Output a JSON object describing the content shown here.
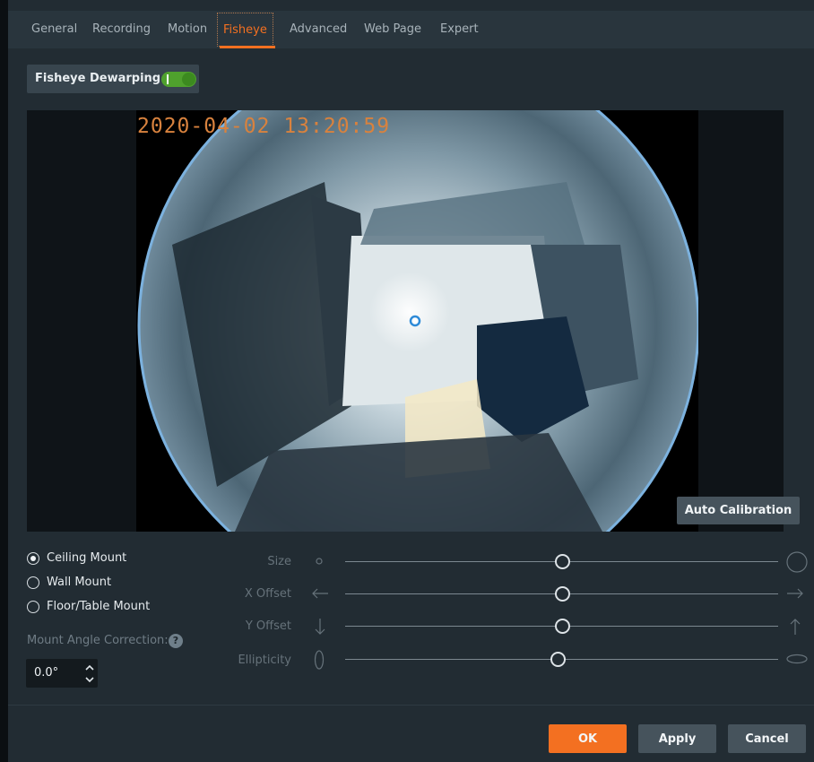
{
  "tabs": [
    {
      "label": "General",
      "active": false
    },
    {
      "label": "Recording",
      "active": false
    },
    {
      "label": "Motion",
      "active": false
    },
    {
      "label": "Fisheye",
      "active": true
    },
    {
      "label": "Advanced",
      "active": false
    },
    {
      "label": "Web Page",
      "active": false
    },
    {
      "label": "Expert",
      "active": false
    }
  ],
  "dewarping": {
    "label": "Fisheye Dewarping",
    "enabled": true
  },
  "video": {
    "timestamp": "2020-04-02 13:20:59",
    "auto_calibration_label": "Auto Calibration"
  },
  "mount": {
    "options": [
      {
        "label": "Ceiling Mount",
        "selected": true
      },
      {
        "label": "Wall Mount",
        "selected": false
      },
      {
        "label": "Floor/Table Mount",
        "selected": false
      }
    ],
    "angle_correction_label": "Mount Angle Correction:",
    "angle_value": "0.0°"
  },
  "sliders": [
    {
      "label": "Size",
      "value_fraction": 0.5,
      "min_icon": "small-circle-icon",
      "max_icon": "large-circle-icon"
    },
    {
      "label": "X Offset",
      "value_fraction": 0.5,
      "min_icon": "arrow-left-icon",
      "max_icon": "arrow-right-icon"
    },
    {
      "label": "Y Offset",
      "value_fraction": 0.5,
      "min_icon": "arrow-down-icon",
      "max_icon": "arrow-up-icon"
    },
    {
      "label": "Ellipticity",
      "value_fraction": 0.49,
      "min_icon": "vertical-ellipse-icon",
      "max_icon": "horizontal-ellipse-icon"
    }
  ],
  "buttons": {
    "ok": "OK",
    "apply": "Apply",
    "cancel": "Cancel"
  },
  "colors": {
    "accent": "#f37021",
    "toggle_on": "#4fa12d",
    "background": "#222c33"
  }
}
